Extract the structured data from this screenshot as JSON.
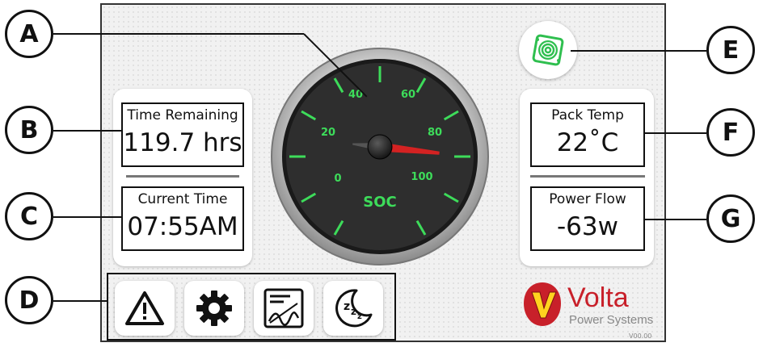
{
  "callouts": {
    "a": "A",
    "b": "B",
    "c": "C",
    "d": "D",
    "e": "E",
    "f": "F",
    "g": "G"
  },
  "gauge": {
    "tick_labels": [
      "0",
      "20",
      "40",
      "60",
      "80",
      "100"
    ],
    "label": "SOC",
    "value": 82,
    "colors": {
      "accent": "#3ddc5a",
      "needle": "#d42222",
      "face": "#2e2e2e"
    }
  },
  "left_panel": {
    "time_remaining": {
      "label": "Time Remaining",
      "value": "119.7 hrs"
    },
    "current_time": {
      "label": "Current Time",
      "value": "07:55AM"
    }
  },
  "right_panel": {
    "pack_temp": {
      "label": "Pack Temp",
      "value": "22˚C"
    },
    "power_flow": {
      "label": "Power Flow",
      "value": "-63w"
    }
  },
  "toolbar": {
    "buttons": [
      {
        "icon": "warning-icon"
      },
      {
        "icon": "gear-icon"
      },
      {
        "icon": "charge-curve-icon"
      },
      {
        "icon": "sleep-icon"
      }
    ]
  },
  "fan_button": {
    "icon": "fan-icon",
    "color": "#2fbf4f"
  },
  "brand": {
    "name": "Volta",
    "tagline": "Power Systems",
    "color": "#c8202a"
  },
  "version": "V00.00"
}
